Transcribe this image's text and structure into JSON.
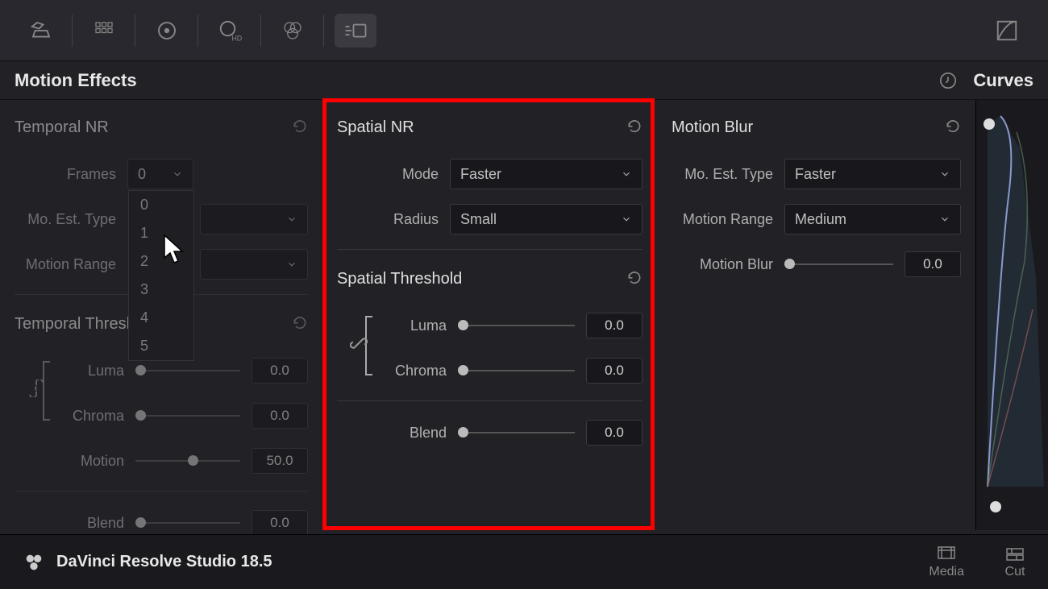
{
  "panel_title": "Motion Effects",
  "curves_label": "Curves",
  "temporal_nr": {
    "title": "Temporal NR",
    "frames_label": "Frames",
    "frames_value": "0",
    "frames_options": [
      "0",
      "1",
      "2",
      "3",
      "4",
      "5"
    ],
    "mo_est_label": "Mo. Est. Type",
    "mo_est_value": "",
    "motion_range_label": "Motion Range",
    "motion_range_value": ""
  },
  "temporal_threshold": {
    "title": "Temporal Threshold",
    "luma_label": "Luma",
    "luma_value": "0.0",
    "chroma_label": "Chroma",
    "chroma_value": "0.0",
    "motion_label": "Motion",
    "motion_value": "50.0",
    "blend_label": "Blend",
    "blend_value": "0.0"
  },
  "spatial_nr": {
    "title": "Spatial NR",
    "mode_label": "Mode",
    "mode_value": "Faster",
    "radius_label": "Radius",
    "radius_value": "Small"
  },
  "spatial_threshold": {
    "title": "Spatial Threshold",
    "luma_label": "Luma",
    "luma_value": "0.0",
    "chroma_label": "Chroma",
    "chroma_value": "0.0",
    "blend_label": "Blend",
    "blend_value": "0.0"
  },
  "motion_blur": {
    "title": "Motion Blur",
    "mo_est_label": "Mo. Est. Type",
    "mo_est_value": "Faster",
    "motion_range_label": "Motion Range",
    "motion_range_value": "Medium",
    "blur_label": "Motion Blur",
    "blur_value": "0.0"
  },
  "app_name": "DaVinci Resolve Studio 18.5",
  "page_tabs": {
    "media": "Media",
    "cut": "Cut"
  }
}
